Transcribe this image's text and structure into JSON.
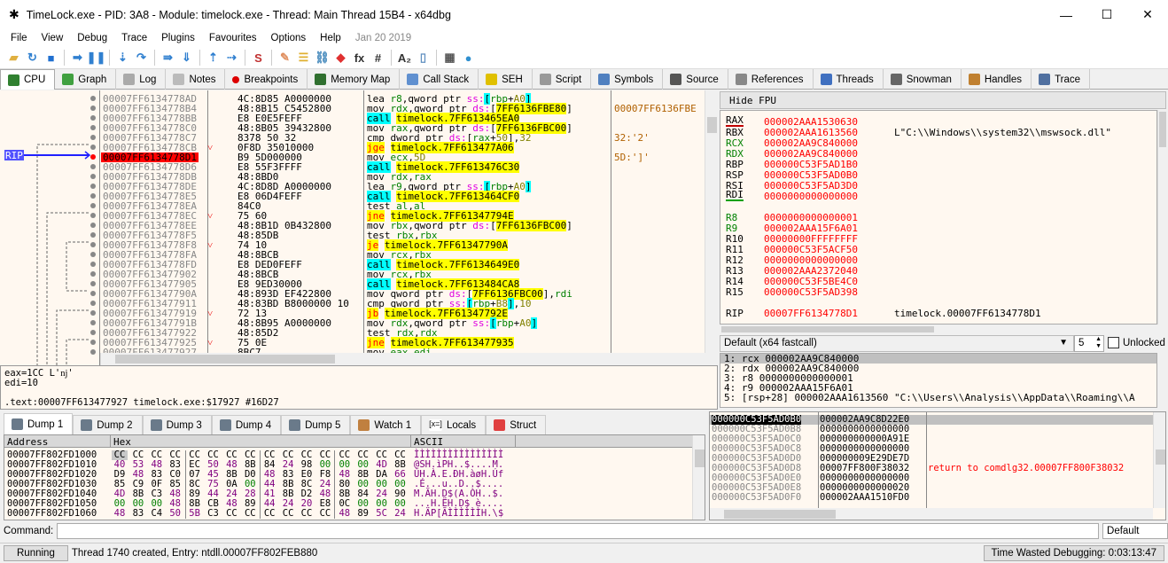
{
  "window": {
    "title": "TimeLock.exe - PID: 3A8 - Module: timelock.exe - Thread: Main Thread 15B4 - x64dbg",
    "minimize": "—",
    "maximize": "☐",
    "close": "✕"
  },
  "menu": [
    "File",
    "View",
    "Debug",
    "Trace",
    "Plugins",
    "Favourites",
    "Options",
    "Help"
  ],
  "menu_date": "Jan 20 2019",
  "toolbar": [
    {
      "name": "open-icon",
      "glyph": "▰",
      "color": "#e0b040"
    },
    {
      "name": "restart-icon",
      "glyph": "↻",
      "color": "#3080d0"
    },
    {
      "name": "stop-icon",
      "glyph": "■",
      "color": "#2070d0"
    },
    {
      "sep": true
    },
    {
      "name": "run-icon",
      "glyph": "➡",
      "color": "#3080d0"
    },
    {
      "name": "pause-icon",
      "glyph": "❚❚",
      "color": "#3080d0"
    },
    {
      "sep": true
    },
    {
      "name": "step-into-icon",
      "glyph": "⇣",
      "color": "#3080d0"
    },
    {
      "name": "step-over-icon",
      "glyph": "↷",
      "color": "#3080d0"
    },
    {
      "sep": true
    },
    {
      "name": "trace-into-icon",
      "glyph": "⇛",
      "color": "#3080d0"
    },
    {
      "name": "trace-over-icon",
      "glyph": "⇓",
      "color": "#3080d0"
    },
    {
      "sep": true
    },
    {
      "name": "execute-till-return-icon",
      "glyph": "⇡",
      "color": "#3080d0"
    },
    {
      "name": "run-to-user-code-icon",
      "glyph": "⇢",
      "color": "#3080d0"
    },
    {
      "sep": true
    },
    {
      "name": "scylla-icon",
      "glyph": "S",
      "color": "#c03030"
    },
    {
      "sep": true
    },
    {
      "name": "patch-icon",
      "glyph": "✎",
      "color": "#e09060"
    },
    {
      "name": "comments-icon",
      "glyph": "☰",
      "color": "#e0b030"
    },
    {
      "name": "labels-icon",
      "glyph": "⛓",
      "color": "#5090c0"
    },
    {
      "name": "bookmarks-icon",
      "glyph": "◆",
      "color": "#e03030"
    },
    {
      "name": "functions-icon",
      "glyph": "fx",
      "color": "#333"
    },
    {
      "name": "variables-icon",
      "glyph": "#",
      "color": "#333"
    },
    {
      "sep": true
    },
    {
      "name": "strings-icon",
      "glyph": "A₂",
      "color": "#333"
    },
    {
      "name": "device-icon",
      "glyph": "▯",
      "color": "#6090c0"
    },
    {
      "sep": true
    },
    {
      "name": "calculator-icon",
      "glyph": "▦",
      "color": "#555"
    },
    {
      "name": "globe-icon",
      "glyph": "●",
      "color": "#3090d0"
    }
  ],
  "tabs": [
    {
      "label": "CPU",
      "icon": "cpu-icon",
      "color": "#308030",
      "active": true
    },
    {
      "label": "Graph",
      "icon": "graph-icon",
      "color": "#40a040"
    },
    {
      "label": "Log",
      "icon": "log-icon",
      "color": "#aaa"
    },
    {
      "label": "Notes",
      "icon": "notes-icon",
      "color": "#bbb"
    },
    {
      "label": "Breakpoints",
      "icon": "breakpoint-icon",
      "color": "#d00"
    },
    {
      "label": "Memory Map",
      "icon": "memory-map-icon",
      "color": "#307030"
    },
    {
      "label": "Call Stack",
      "icon": "call-stack-icon",
      "color": "#6090d0"
    },
    {
      "label": "SEH",
      "icon": "seh-icon",
      "color": "#e0c000"
    },
    {
      "label": "Script",
      "icon": "script-icon",
      "color": "#999"
    },
    {
      "label": "Symbols",
      "icon": "symbols-icon",
      "color": "#5080c0"
    },
    {
      "label": "Source",
      "icon": "source-icon",
      "color": "#555"
    },
    {
      "label": "References",
      "icon": "references-icon",
      "color": "#888"
    },
    {
      "label": "Threads",
      "icon": "threads-icon",
      "color": "#4070c0"
    },
    {
      "label": "Snowman",
      "icon": "snowman-icon",
      "color": "#666"
    },
    {
      "label": "Handles",
      "icon": "handles-icon",
      "color": "#c08030"
    },
    {
      "label": "Trace",
      "icon": "trace-icon",
      "color": "#5070a0"
    }
  ],
  "disasm": {
    "rip_label": "RIP",
    "rows": [
      {
        "addr": "00007FF6134778AD",
        "bytes": "4C:8D85 A0000000",
        "mn": "lea",
        "ops": "r8,qword ptr ss:[rbp+A0]",
        "comment": ""
      },
      {
        "addr": "00007FF6134778B4",
        "bytes": "48:8B15 C5452800",
        "mn": "mov",
        "ops": "rdx,qword ptr ds:[7FF6136FBE80]",
        "comment": "00007FF6136FBE"
      },
      {
        "addr": "00007FF6134778BB",
        "bytes": "E8 E0E5FEFF",
        "mn": "call",
        "ops": "timelock.7FF613465EA0",
        "comment": ""
      },
      {
        "addr": "00007FF6134778C0",
        "bytes": "48:8B05 39432800",
        "mn": "mov",
        "ops": "rax,qword ptr ds:[7FF6136FBC00]",
        "comment": ""
      },
      {
        "addr": "00007FF6134778C7",
        "bytes": "8378 50 32",
        "mn": "cmp",
        "ops": "dword ptr ds:[rax+50],32",
        "comment": "32:'2'"
      },
      {
        "addr": "00007FF6134778CB",
        "bytes": "0F8D 35010000",
        "mark": "˅",
        "mn": "jge",
        "ops": "timelock.7FF613477A06",
        "comment": ""
      },
      {
        "addr": "00007FF6134778D1",
        "bytes": "B9 5D000000",
        "rip": true,
        "mn": "mov",
        "ops": "ecx,5D",
        "comment": "5D:']'"
      },
      {
        "addr": "00007FF6134778D6",
        "bytes": "E8 55F3FFFF",
        "mn": "call",
        "ops": "timelock.7FF613476C30",
        "comment": ""
      },
      {
        "addr": "00007FF6134778DB",
        "bytes": "48:8BD0",
        "mn": "mov",
        "ops": "rdx,rax",
        "comment": ""
      },
      {
        "addr": "00007FF6134778DE",
        "bytes": "4C:8D8D A0000000",
        "mn": "lea",
        "ops": "r9,qword ptr ss:[rbp+A0]",
        "comment": ""
      },
      {
        "addr": "00007FF6134778E5",
        "bytes": "E8 06D4FEFF",
        "mn": "call",
        "ops": "timelock.7FF613464CF0",
        "comment": ""
      },
      {
        "addr": "00007FF6134778EA",
        "bytes": "84C0",
        "mn": "test",
        "ops": "al,al",
        "comment": ""
      },
      {
        "addr": "00007FF6134778EC",
        "bytes": "75 60",
        "mark": "˅",
        "mn": "jne",
        "ops": "timelock.7FF61347794E",
        "comment": ""
      },
      {
        "addr": "00007FF6134778EE",
        "bytes": "48:8B1D 0B432800",
        "mn": "mov",
        "ops": "rbx,qword ptr ds:[7FF6136FBC00]",
        "comment": ""
      },
      {
        "addr": "00007FF6134778F5",
        "bytes": "48:85DB",
        "mn": "test",
        "ops": "rbx,rbx",
        "comment": ""
      },
      {
        "addr": "00007FF6134778F8",
        "bytes": "74 10",
        "mark": "˅",
        "mn": "je",
        "ops": "timelock.7FF61347790A",
        "comment": ""
      },
      {
        "addr": "00007FF6134778FA",
        "bytes": "48:8BCB",
        "mn": "mov",
        "ops": "rcx,rbx",
        "comment": ""
      },
      {
        "addr": "00007FF6134778FD",
        "bytes": "E8 DED0FEFF",
        "mn": "call",
        "ops": "timelock.7FF6134649E0",
        "comment": ""
      },
      {
        "addr": "00007FF613477902",
        "bytes": "48:8BCB",
        "mn": "mov",
        "ops": "rcx,rbx",
        "comment": ""
      },
      {
        "addr": "00007FF613477905",
        "bytes": "E8 9ED30000",
        "mn": "call",
        "ops": "timelock.7FF613484CA8",
        "comment": ""
      },
      {
        "addr": "00007FF61347790A",
        "bytes": "48:893D EF422800",
        "mn": "mov",
        "ops": "qword ptr ds:[7FF6136FBC00],rdi",
        "comment": ""
      },
      {
        "addr": "00007FF613477911",
        "bytes": "48:83BD B8000000 10",
        "mn": "cmp",
        "ops": "qword ptr ss:[rbp+B8],10",
        "comment": ""
      },
      {
        "addr": "00007FF613477919",
        "bytes": "72 13",
        "mark": "˅",
        "mn": "jb",
        "ops": "timelock.7FF61347792E",
        "comment": ""
      },
      {
        "addr": "00007FF61347791B",
        "bytes": "48:8B95 A0000000",
        "mn": "mov",
        "ops": "rdx,qword ptr ss:[rbp+A0]",
        "comment": ""
      },
      {
        "addr": "00007FF613477922",
        "bytes": "48:85D2",
        "mn": "test",
        "ops": "rdx,rdx",
        "comment": ""
      },
      {
        "addr": "00007FF613477925",
        "bytes": "75 0E",
        "mark": "˅",
        "mn": "jne",
        "ops": "timelock.7FF613477935",
        "comment": ""
      },
      {
        "addr": "00007FF613477927",
        "bytes": "8BC7",
        "mn": "mov",
        "ops": "eax,edi",
        "comment": ""
      }
    ]
  },
  "info": {
    "lines": [
      "eax=1CC L'ǌ'",
      "edi=10",
      "",
      ".text:00007FF613477927 timelock.exe:$17927 #16D27"
    ]
  },
  "registers": {
    "hide_fpu": "Hide FPU",
    "rows": [
      {
        "name": "RAX",
        "value": "000002AAA1530630",
        "comment": "",
        "nc": "#000",
        "ul": "#c00000"
      },
      {
        "name": "RBX",
        "value": "000002AAA1613560",
        "comment": "L\"C:\\\\Windows\\\\system32\\\\mswsock.dll\"",
        "nc": "#000"
      },
      {
        "name": "RCX",
        "value": "000002AA9C840000",
        "comment": "",
        "nc": "#008000"
      },
      {
        "name": "RDX",
        "value": "000002AA9C840000",
        "comment": "",
        "nc": "#008000"
      },
      {
        "name": "RBP",
        "value": "000000C53F5AD1B0",
        "comment": "",
        "nc": "#000"
      },
      {
        "name": "RSP",
        "value": "000000C53F5AD0B0",
        "comment": "",
        "nc": "#000"
      },
      {
        "name": "RSI",
        "value": "000000C53F5AD3D0",
        "comment": "",
        "nc": "#000"
      },
      {
        "name": "RDI",
        "value": "0000000000000000",
        "comment": "",
        "nc": "#000",
        "ul": "#00a000"
      },
      {
        "gap": true
      },
      {
        "name": "R8",
        "value": "0000000000000001",
        "comment": "",
        "nc": "#008000"
      },
      {
        "name": "R9",
        "value": "000002AAA15F6A01",
        "comment": "",
        "nc": "#008000"
      },
      {
        "name": "R10",
        "value": "00000000FFFFFFFF",
        "comment": "",
        "nc": "#000"
      },
      {
        "name": "R11",
        "value": "000000C53F5ACF50",
        "comment": "",
        "nc": "#000"
      },
      {
        "name": "R12",
        "value": "0000000000000000",
        "comment": "",
        "nc": "#000"
      },
      {
        "name": "R13",
        "value": "000002AAA2372040",
        "comment": "",
        "nc": "#000"
      },
      {
        "name": "R14",
        "value": "000000C53F5BE4C0",
        "comment": "",
        "nc": "#000"
      },
      {
        "name": "R15",
        "value": "000000C53F5AD398",
        "comment": "",
        "nc": "#000"
      },
      {
        "gap": true
      },
      {
        "name": "RIP",
        "value": "00007FF6134778D1",
        "comment": "timelock.00007FF6134778D1",
        "nc": "#000"
      }
    ]
  },
  "callconv": {
    "selected": "Default (x64 fastcall)",
    "count": "5",
    "unlocked_label": "Unlocked",
    "unlocked": false
  },
  "args": [
    "1: rcx 000002AA9C840000",
    "2: rdx 000002AA9C840000",
    "3: r8 0000000000000001",
    "4: r9 000002AAA15F6A01",
    "5: [rsp+28] 000002AAA1613560 \"C:\\\\Users\\\\Analysis\\\\AppData\\\\Roaming\\\\A"
  ],
  "dump_tabs": [
    {
      "label": "Dump 1",
      "icon": "dump-icon",
      "active": true
    },
    {
      "label": "Dump 2",
      "icon": "dump-icon"
    },
    {
      "label": "Dump 3",
      "icon": "dump-icon"
    },
    {
      "label": "Dump 4",
      "icon": "dump-icon"
    },
    {
      "label": "Dump 5",
      "icon": "dump-icon"
    },
    {
      "label": "Watch 1",
      "icon": "watch-icon"
    },
    {
      "label": "Locals",
      "icon": "locals-icon"
    },
    {
      "label": "Struct",
      "icon": "struct-icon"
    }
  ],
  "dump": {
    "headers": [
      "Address",
      "Hex",
      "ASCII"
    ],
    "rows": [
      {
        "addr": "00007FF802FD1000",
        "hex": [
          "CC",
          "CC",
          "CC",
          "CC",
          "CC",
          "CC",
          "CC",
          "CC",
          "CC",
          "CC",
          "CC",
          "CC",
          "CC",
          "CC",
          "CC",
          "CC"
        ],
        "ascii": "ÌÌÌÌÌÌÌÌÌÌÌÌÌÌÌÌ"
      },
      {
        "addr": "00007FF802FD1010",
        "hex": [
          "40",
          "53",
          "48",
          "83",
          "EC",
          "50",
          "48",
          "8B",
          "84",
          "24",
          "98",
          "00",
          "00",
          "00",
          "4D",
          "8B"
        ],
        "ascii": "@SH.ìPH..$....M."
      },
      {
        "addr": "00007FF802FD1020",
        "hex": [
          "D9",
          "48",
          "83",
          "C0",
          "07",
          "45",
          "8B",
          "D0",
          "48",
          "83",
          "E0",
          "F8",
          "48",
          "8B",
          "DA",
          "66"
        ],
        "ascii": "ÙH.À.E.ÐH.àøH.Úf"
      },
      {
        "addr": "00007FF802FD1030",
        "hex": [
          "85",
          "C9",
          "0F",
          "85",
          "8C",
          "75",
          "0A",
          "00",
          "44",
          "8B",
          "8C",
          "24",
          "80",
          "00",
          "00",
          "00"
        ],
        "ascii": ".É...u..D..$...."
      },
      {
        "addr": "00007FF802FD1040",
        "hex": [
          "4D",
          "8B",
          "C3",
          "48",
          "89",
          "44",
          "24",
          "28",
          "41",
          "8B",
          "D2",
          "48",
          "8B",
          "84",
          "24",
          "90"
        ],
        "ascii": "M.ÃH.D$(A.ÒH..$."
      },
      {
        "addr": "00007FF802FD1050",
        "hex": [
          "00",
          "00",
          "00",
          "48",
          "8B",
          "CB",
          "48",
          "89",
          "44",
          "24",
          "20",
          "E8",
          "0C",
          "00",
          "00",
          "00"
        ],
        "ascii": "...H.ËH.D$ è...."
      },
      {
        "addr": "00007FF802FD1060",
        "hex": [
          "48",
          "83",
          "C4",
          "50",
          "5B",
          "C3",
          "CC",
          "CC",
          "CC",
          "CC",
          "CC",
          "CC",
          "48",
          "89",
          "5C",
          "24"
        ],
        "ascii": "H.ÄP[ÃÌÌÌÌÌÌH.\\$"
      }
    ]
  },
  "stack": {
    "rows": [
      {
        "addr": "000000C53F5AD0B0",
        "value": "000002AA9C8D22E0",
        "comment": "",
        "current": true
      },
      {
        "addr": "000000C53F5AD0B8",
        "value": "0000000000000000",
        "comment": ""
      },
      {
        "addr": "000000C53F5AD0C0",
        "value": "000000000000A91E",
        "comment": ""
      },
      {
        "addr": "000000C53F5AD0C8",
        "value": "0000000000000000",
        "comment": ""
      },
      {
        "addr": "000000C53F5AD0D0",
        "value": "000000009E29DE7D",
        "comment": ""
      },
      {
        "addr": "000000C53F5AD0D8",
        "value": "00007FF800F38032",
        "comment": "return to comdlg32.00007FF800F38032"
      },
      {
        "addr": "000000C53F5AD0E0",
        "value": "0000000000000000",
        "comment": ""
      },
      {
        "addr": "000000C53F5AD0E8",
        "value": "0000000000000020",
        "comment": ""
      },
      {
        "addr": "000000C53F5AD0F0",
        "value": "000002AAA1510FD0",
        "comment": ""
      }
    ]
  },
  "command": {
    "label": "Command:",
    "value": "",
    "mode": "Default"
  },
  "status": {
    "state": "Running",
    "message": "Thread 1740 created, Entry: ntdll.00007FF802FEB880",
    "time": "Time Wasted Debugging: 0:03:13:47"
  }
}
